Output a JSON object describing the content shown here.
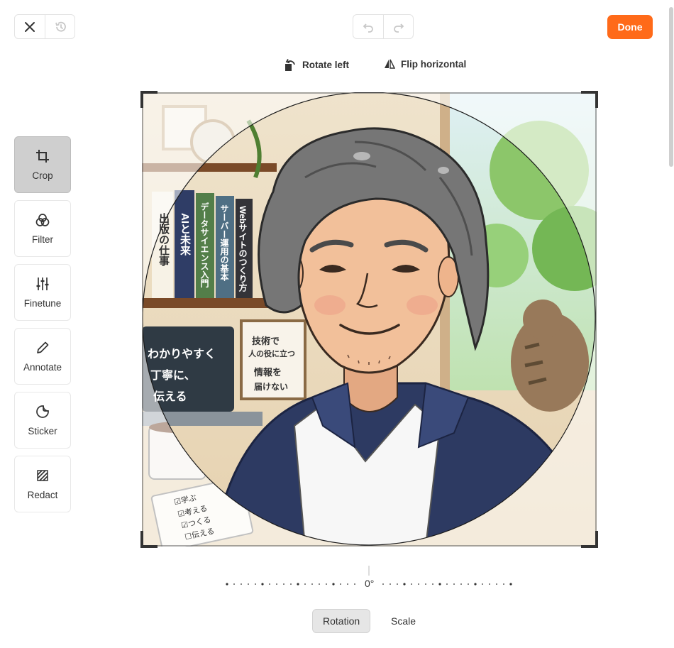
{
  "toolbar": {
    "done_label": "Done",
    "close_icon": "close-icon",
    "revert_icon": "history-icon",
    "undo_icon": "undo-icon",
    "redo_icon": "redo-icon",
    "accent_color": "#ff6a19"
  },
  "crop_actions": {
    "rotate_left": "Rotate left",
    "flip_horizontal": "Flip horizontal"
  },
  "sidebar": {
    "items": [
      {
        "label": "Crop",
        "icon": "crop-icon",
        "active": true
      },
      {
        "label": "Filter",
        "icon": "filter-icon",
        "active": false
      },
      {
        "label": "Finetune",
        "icon": "sliders-icon",
        "active": false
      },
      {
        "label": "Annotate",
        "icon": "pencil-icon",
        "active": false
      },
      {
        "label": "Sticker",
        "icon": "sticker-icon",
        "active": false
      },
      {
        "label": "Redact",
        "icon": "redact-icon",
        "active": false
      }
    ]
  },
  "image": {
    "book_titles": [
      "出版の仕事",
      "AIと未来",
      "データサイエンス入門",
      "サーバー運用の基本",
      "Webサイトのつくり方"
    ],
    "laptop_text": [
      "わかりやすく",
      "丁寧に、",
      "伝える"
    ],
    "frame_text": [
      "技術で",
      "人の役に立つ",
      "情報を",
      "届けない"
    ],
    "notebook_text": [
      "☑学ぶ",
      "☑考える",
      "☑つくる",
      "☐伝える"
    ]
  },
  "dial": {
    "value_label": "0°",
    "value": 0
  },
  "tabs": {
    "rotation": "Rotation",
    "scale": "Scale",
    "active": "rotation"
  }
}
